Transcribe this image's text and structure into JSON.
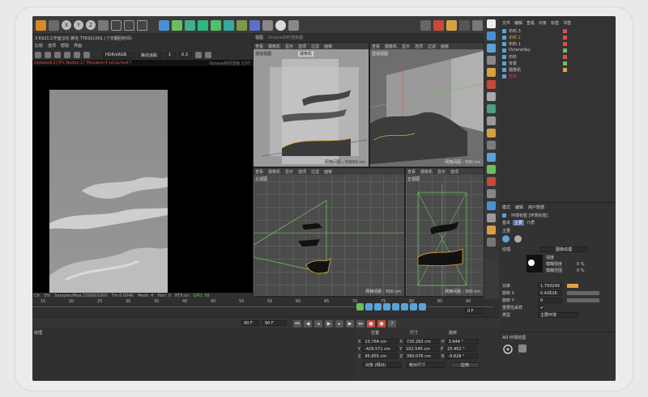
{
  "top_toolbar": {
    "axes": [
      "X",
      "Y",
      "Z"
    ]
  },
  "viewer": {
    "title_line": "3  K921工作室汉化 微信 TTK921001  (了天翻回时间)",
    "menu": [
      "比较",
      "选项",
      "帮助",
      "界面"
    ],
    "color_mode": "HDR/sRGB",
    "bake_label": "路径追踪",
    "value_1": "1",
    "value_2": "0.3",
    "status_left": "Updated[2] 0%  Nodes:17 Movable:4  txCached:?",
    "status_right": "Octane实时渲染 3.07",
    "footer": [
      "Cfr",
      "0%",
      "Samples/Max:10000/1000",
      "Tm:0.0046",
      "Mesh: 4",
      "Hair: 0",
      "RTX:on",
      "GPU: 58"
    ]
  },
  "viewports": {
    "header_tabs": [
      "视图",
      "Octane实时渲染器"
    ],
    "menu": [
      "查看",
      "摄像机",
      "显示",
      "选项",
      "过滤",
      "面板"
    ],
    "top_left": {
      "name": "透视视图",
      "camera": "摄像机",
      "footer": "网格间距 : 50000 cm"
    },
    "top_right": {
      "name": "透视视图",
      "footer": "网格间距 : 500 cm"
    },
    "bottom_left": {
      "name": "右视图",
      "footer": "网格间距 : 500 cm"
    },
    "bottom_right": {
      "name": "正视图",
      "footer": "网格间距 : 500 cm"
    }
  },
  "object_manager": {
    "menu": [
      "文件",
      "编辑",
      "查看",
      "对象",
      "标签",
      "书签"
    ],
    "objects": [
      {
        "name": "布料.3",
        "color": "#c8c8c8"
      },
      {
        "name": "布料.2",
        "color": "#e2a23c"
      },
      {
        "name": "布料.1",
        "color": "#c8c8c8"
      },
      {
        "name": "OctaneSky",
        "color": "#c8c8c8"
      },
      {
        "name": "布料",
        "color": "#c8c8c8"
      },
      {
        "name": "背景",
        "color": "#c8c8c8"
      },
      {
        "name": "摄像机",
        "color": "#c8c8c8"
      },
      {
        "name": "空白",
        "color": "#e24c4c"
      }
    ]
  },
  "attributes": {
    "menu": [
      "模式",
      "编辑",
      "用户数据"
    ],
    "title": "环境标签 [环境标签]",
    "tabs": [
      "基本",
      "主要",
      "介质"
    ],
    "section": "主要",
    "texture_label": "纹理",
    "image_texture": "图像纹理",
    "preview_rows": [
      {
        "label": "强度",
        "value": ""
      },
      {
        "label": "模糊强度",
        "value": "0 %"
      },
      {
        "label": "模糊范围",
        "value": "0 %"
      }
    ],
    "params": [
      {
        "label": "功率",
        "value": "1.793249"
      },
      {
        "label": "旋转 X",
        "value": "0.42616"
      },
      {
        "label": "旋转 Y",
        "value": "0"
      },
      {
        "label": "重要性采样",
        "value": "✔"
      },
      {
        "label": "类型",
        "value": "主要环境"
      }
    ],
    "ao_label": "AO 环境纹理"
  },
  "timeline": {
    "ticks": [
      "15",
      "20",
      "25",
      "30",
      "35",
      "40",
      "45",
      "50",
      "55",
      "60",
      "65",
      "70",
      "75",
      "80",
      "85",
      "90"
    ],
    "start_frame": "0 F",
    "end_frame": "90 F",
    "end_frame_2": "90 F"
  },
  "material_panel": {
    "label": "纹理"
  },
  "coordinates": {
    "headers": [
      "位置",
      "尺寸",
      "旋转"
    ],
    "rows": [
      {
        "axis": "X",
        "pos": "23.764 cm",
        "size_axis": "X",
        "size": "720.263 cm",
        "rot_axis": "H",
        "rot": "3.944 °"
      },
      {
        "axis": "Y",
        "pos": "-429.571 cm",
        "size_axis": "Y",
        "size": "102.545 cm",
        "rot_axis": "P",
        "rot": "25.452 °"
      },
      {
        "axis": "Z",
        "pos": "95.855 cm",
        "size_axis": "Z",
        "size": "390.076 cm",
        "rot_axis": "B",
        "rot": "-9.828 °"
      }
    ],
    "mode": "对象 (相对)",
    "size_mode": "绝对尺寸",
    "apply": "应用"
  },
  "colors": {
    "accent": "#e2a23c",
    "bg": "#3a3a3a",
    "panel": "#2e2e2e"
  }
}
